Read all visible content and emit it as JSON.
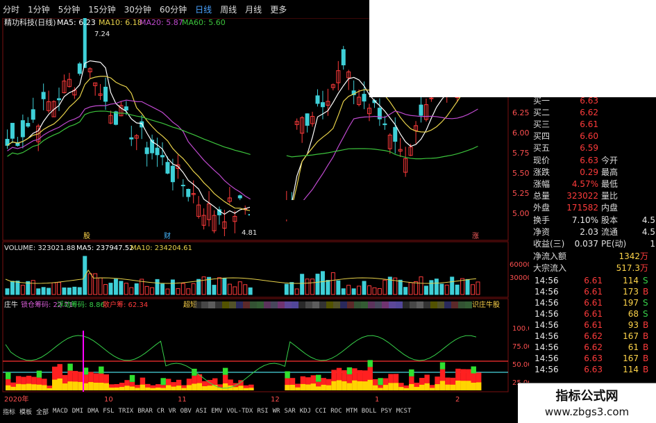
{
  "toolbar": {
    "items": [
      "分时",
      "1分钟",
      "5分钟",
      "15分钟",
      "30分钟",
      "60分钟",
      "日线",
      "周线",
      "月线",
      "更多"
    ],
    "active": "日线"
  },
  "kline": {
    "title": "精功科技(日线)",
    "ma5": "MA5: 6.23",
    "ma10": "MA10: 6.18",
    "ma20": "MA20: 5.87",
    "ma60": "MA60: 5.60",
    "high_label": "7.24",
    "low_label": "4.81",
    "price_axis": [
      "6.25",
      "6.00",
      "5.75",
      "5.50",
      "5.25",
      "5.00"
    ],
    "event_labels": [
      "股",
      "财",
      "涨"
    ]
  },
  "volume": {
    "title": "VOLUME: 323021.88",
    "ma5": "MA5: 237947.52",
    "ma10": "MA10: 234204.61",
    "axis": [
      "60000",
      "30000"
    ]
  },
  "indicator": {
    "title": "庄牛",
    "a": "锁仓筹码: 22.71",
    "b": "浮动筹码: 8.86",
    "c": "散户筹: 62.34",
    "d": "超短",
    "e": "识庄牛股",
    "axis": [
      "100.0",
      "75.00",
      "50.00",
      "25.00"
    ]
  },
  "date_axis": [
    "2020年",
    "10",
    "11",
    "12",
    "1",
    "2"
  ],
  "bottom_tabs": [
    "指标",
    "模板",
    "全部",
    "MACD",
    "DMI",
    "DMA",
    "FSL",
    "TRIX",
    "BRAR",
    "CR",
    "VR",
    "OBV",
    "ASI",
    "EMV",
    "VOL-TDX",
    "RSI",
    "WR",
    "SAR",
    "KDJ",
    "CCI",
    "ROC",
    "MTM",
    "BOLL",
    "PSY",
    "MCST"
  ],
  "quote": {
    "bids": [
      {
        "label": "买一",
        "value": "6.63"
      },
      {
        "label": "买二",
        "value": "6.62"
      },
      {
        "label": "买三",
        "value": "6.61"
      },
      {
        "label": "买四",
        "value": "6.60"
      },
      {
        "label": "买五",
        "value": "6.59"
      }
    ],
    "rows": [
      {
        "l1": "现价",
        "v1": "6.63",
        "l2": "今开",
        "v2": ""
      },
      {
        "l1": "涨跌",
        "v1": "0.29",
        "l2": "最高",
        "v2": ""
      },
      {
        "l1": "涨幅",
        "v1": "4.57%",
        "l2": "最低",
        "v2": ""
      },
      {
        "l1": "总量",
        "v1": "323022",
        "l2": "量比",
        "v2": ""
      },
      {
        "l1": "外盘",
        "v1": "171582",
        "l2": "内盘",
        "v2": ""
      }
    ],
    "stats": [
      {
        "l1": "换手",
        "v1": "7.10%",
        "l2": "股本",
        "v2": "4.5"
      },
      {
        "l1": "净资",
        "v1": "2.03",
        "l2": "流通",
        "v2": "4.5"
      },
      {
        "l1": "收益(三)",
        "v1": "0.037",
        "l2": "PE(动)",
        "v2": "1"
      }
    ],
    "flow": [
      {
        "label": "净流入额",
        "value": "1342",
        "unit": "万"
      },
      {
        "label": "大宗流入",
        "value": "517.3",
        "unit": "万"
      }
    ],
    "ticks": [
      {
        "t": "14:56",
        "p": "6.61",
        "v": "114",
        "s": "S"
      },
      {
        "t": "14:56",
        "p": "6.61",
        "v": "173",
        "s": "B"
      },
      {
        "t": "14:56",
        "p": "6.61",
        "v": "197",
        "s": "S"
      },
      {
        "t": "14:56",
        "p": "6.61",
        "v": "68",
        "s": "S"
      },
      {
        "t": "14:56",
        "p": "6.61",
        "v": "93",
        "s": "B"
      },
      {
        "t": "14:56",
        "p": "6.62",
        "v": "167",
        "s": "B"
      },
      {
        "t": "14:56",
        "p": "6.62",
        "v": "61",
        "s": "B"
      },
      {
        "t": "14:56",
        "p": "6.63",
        "v": "167",
        "s": "B"
      },
      {
        "t": "14:56",
        "p": "6.63",
        "v": "114",
        "s": "B"
      }
    ]
  },
  "watermark": {
    "title": "指标公式网",
    "url": "www.zbgs3.com"
  },
  "colors": {
    "up": "#ff3b3b",
    "down": "#3fd0d8",
    "ma5": "#ffffff",
    "ma10": "#e8d24a",
    "ma20": "#c04ad0",
    "ma60": "#3cc43c"
  }
}
